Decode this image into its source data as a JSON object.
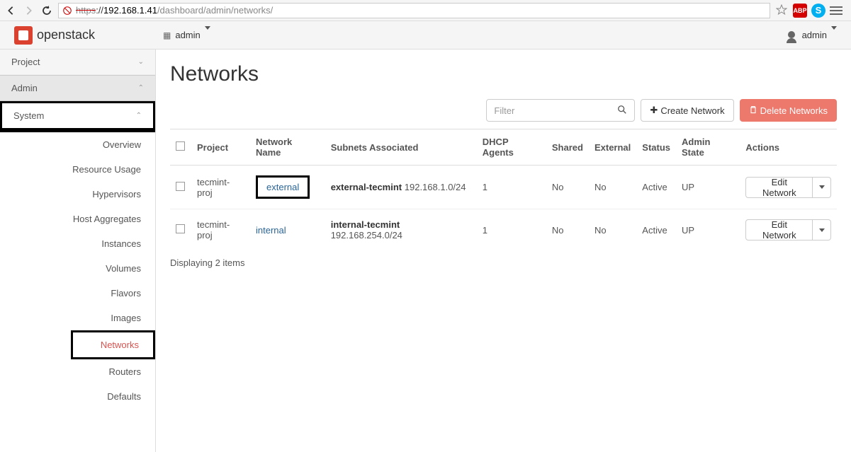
{
  "browser": {
    "url_proto": "https",
    "url_sep": "://",
    "url_host": "192.168.1.41",
    "url_path": "/dashboard/admin/networks/",
    "abp_label": "ABP",
    "skype_label": "S"
  },
  "header": {
    "brand": "openstack",
    "project_selector": "admin",
    "user_menu": "admin"
  },
  "sidebar": {
    "project_label": "Project",
    "admin_label": "Admin",
    "system_label": "System",
    "items": [
      {
        "label": "Overview"
      },
      {
        "label": "Resource Usage"
      },
      {
        "label": "Hypervisors"
      },
      {
        "label": "Host Aggregates"
      },
      {
        "label": "Instances"
      },
      {
        "label": "Volumes"
      },
      {
        "label": "Flavors"
      },
      {
        "label": "Images"
      },
      {
        "label": "Networks",
        "active": true
      },
      {
        "label": "Routers"
      },
      {
        "label": "Defaults"
      }
    ]
  },
  "page": {
    "title": "Networks",
    "filter_placeholder": "Filter",
    "create_label": "Create Network",
    "delete_label": "Delete Networks",
    "columns": {
      "project": "Project",
      "network_name": "Network Name",
      "subnets": "Subnets Associated",
      "dhcp": "DHCP Agents",
      "shared": "Shared",
      "external": "External",
      "status": "Status",
      "admin_state": "Admin State",
      "actions": "Actions"
    },
    "rows": [
      {
        "project": "tecmint-proj",
        "network_name": "external",
        "subnet_name": "external-tecmint",
        "subnet_cidr": "192.168.1.0/24",
        "dhcp": "1",
        "shared": "No",
        "external": "No",
        "status": "Active",
        "admin_state": "UP",
        "action_label": "Edit Network"
      },
      {
        "project": "tecmint-proj",
        "network_name": "internal",
        "subnet_name": "internal-tecmint",
        "subnet_cidr": "192.168.254.0/24",
        "dhcp": "1",
        "shared": "No",
        "external": "No",
        "status": "Active",
        "admin_state": "UP",
        "action_label": "Edit Network"
      }
    ],
    "footer": "Displaying 2 items"
  }
}
